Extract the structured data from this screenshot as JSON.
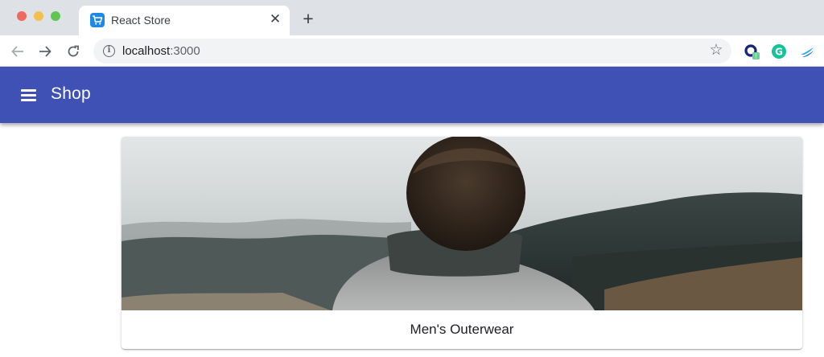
{
  "browser": {
    "tab": {
      "title": "React Store",
      "close_glyph": "✕",
      "favicon": "cart-icon"
    },
    "new_tab_glyph": "+",
    "address": {
      "host": "localhost",
      "port": ":3000"
    },
    "extensions": [
      "chromium-ext-icon",
      "grammarly-icon",
      "swift-ext-icon"
    ]
  },
  "appbar": {
    "title": "Shop",
    "color": "#3f51b5",
    "menu_icon": "menu-icon"
  },
  "card": {
    "label": "Men's Outerwear"
  }
}
